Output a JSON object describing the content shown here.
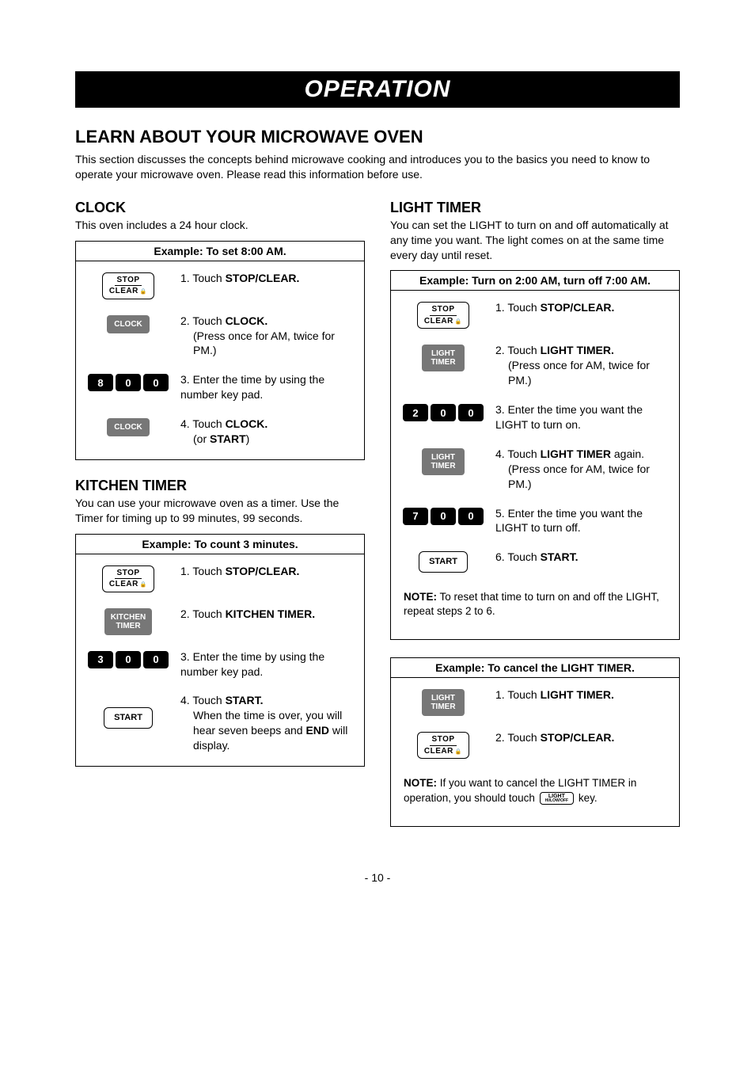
{
  "banner": "OPERATION",
  "mainHeading": "LEARN ABOUT YOUR MICROWAVE OVEN",
  "intro": "This section discusses the concepts behind microwave cooking and introduces you to the basics you need to know to operate your microwave oven. Please read this information before use.",
  "clock": {
    "heading": "CLOCK",
    "desc": "This oven includes a 24 hour clock.",
    "exampleTitle": "Example: To set 8:00 AM.",
    "steps": {
      "s1_pre": "1. Touch ",
      "s1_b": "STOP/CLEAR.",
      "s2_pre": "2. Touch ",
      "s2_b": "CLOCK.",
      "s2_sub": "(Press once for AM, twice for PM.)",
      "s3": "3. Enter the time by using the number key pad.",
      "s4_pre": "4. Touch ",
      "s4_b": "CLOCK.",
      "s4_sub_pre": "(or ",
      "s4_sub_b": "START",
      "s4_sub_post": ")"
    },
    "btn": {
      "stop1": "STOP",
      "stop2": "CLEAR",
      "clock": "CLOCK",
      "k8": "8",
      "k0a": "0",
      "k0b": "0"
    }
  },
  "kitchen": {
    "heading": "KITCHEN TIMER",
    "desc": "You can use your microwave oven as a timer. Use the Timer for timing up to 99 minutes, 99 seconds.",
    "exampleTitle": "Example: To count 3 minutes.",
    "steps": {
      "s1_pre": "1. Touch ",
      "s1_b": "STOP/CLEAR.",
      "s2_pre": "2. Touch ",
      "s2_b": "KITCHEN TIMER.",
      "s3": "3. Enter the time by using the number key pad.",
      "s4_pre": "4. Touch ",
      "s4_b": "START.",
      "s4_sub1": "When the time is over, you will hear seven beeps and ",
      "s4_sub_b": "END",
      "s4_sub2": " will display."
    },
    "btn": {
      "stop1": "STOP",
      "stop2": "CLEAR",
      "kt1": "KITCHEN",
      "kt2": "TIMER",
      "k3": "3",
      "k0a": "0",
      "k0b": "0",
      "start": "START"
    }
  },
  "light": {
    "heading": "LIGHT TIMER",
    "desc": "You can set the LIGHT to turn on and off automatically at any time you want. The light comes on at the same time every day until reset.",
    "exampleTitle": "Example: Turn on 2:00 AM, turn off 7:00 AM.",
    "steps": {
      "s1_pre": "1. Touch ",
      "s1_b": "STOP/CLEAR.",
      "s2_pre": "2. Touch ",
      "s2_b": "LIGHT TIMER.",
      "s2_sub": "(Press once for AM, twice for  PM.)",
      "s3": "3. Enter the time you want the LIGHT to turn on.",
      "s4_pre": "4. Touch ",
      "s4_b": "LIGHT TIMER",
      "s4_post": " again.",
      "s4_sub": "(Press once for AM, twice for PM.)",
      "s5": "5. Enter the time you want the LIGHT to turn off.",
      "s6_pre": "6. Touch ",
      "s6_b": "START."
    },
    "note_b": "NOTE:",
    "note": " To reset that time to turn on and off the LIGHT, repeat steps 2 to 6.",
    "btn": {
      "stop1": "STOP",
      "stop2": "CLEAR",
      "lt1": "LIGHT",
      "lt2": "TIMER",
      "k2": "2",
      "k0a": "0",
      "k0b": "0",
      "k7": "7",
      "k0c": "0",
      "k0d": "0",
      "start": "START"
    }
  },
  "cancel": {
    "exampleTitle": "Example: To cancel the LIGHT TIMER.",
    "steps": {
      "s1_pre": "1. Touch ",
      "s1_b": "LIGHT TIMER.",
      "s2_pre": "2. Touch ",
      "s2_b": "STOP/CLEAR."
    },
    "note_b": "NOTE:",
    "note1": " If you want to cancel the LIGHT TIMER in operation, you should touch ",
    "note2": " key.",
    "btn": {
      "lt1": "LIGHT",
      "lt2": "TIMER",
      "stop1": "STOP",
      "stop2": "CLEAR",
      "ik1": "LIGHT",
      "ik2": "HI/LOW/OFF"
    }
  },
  "pageNum": "- 10 -"
}
